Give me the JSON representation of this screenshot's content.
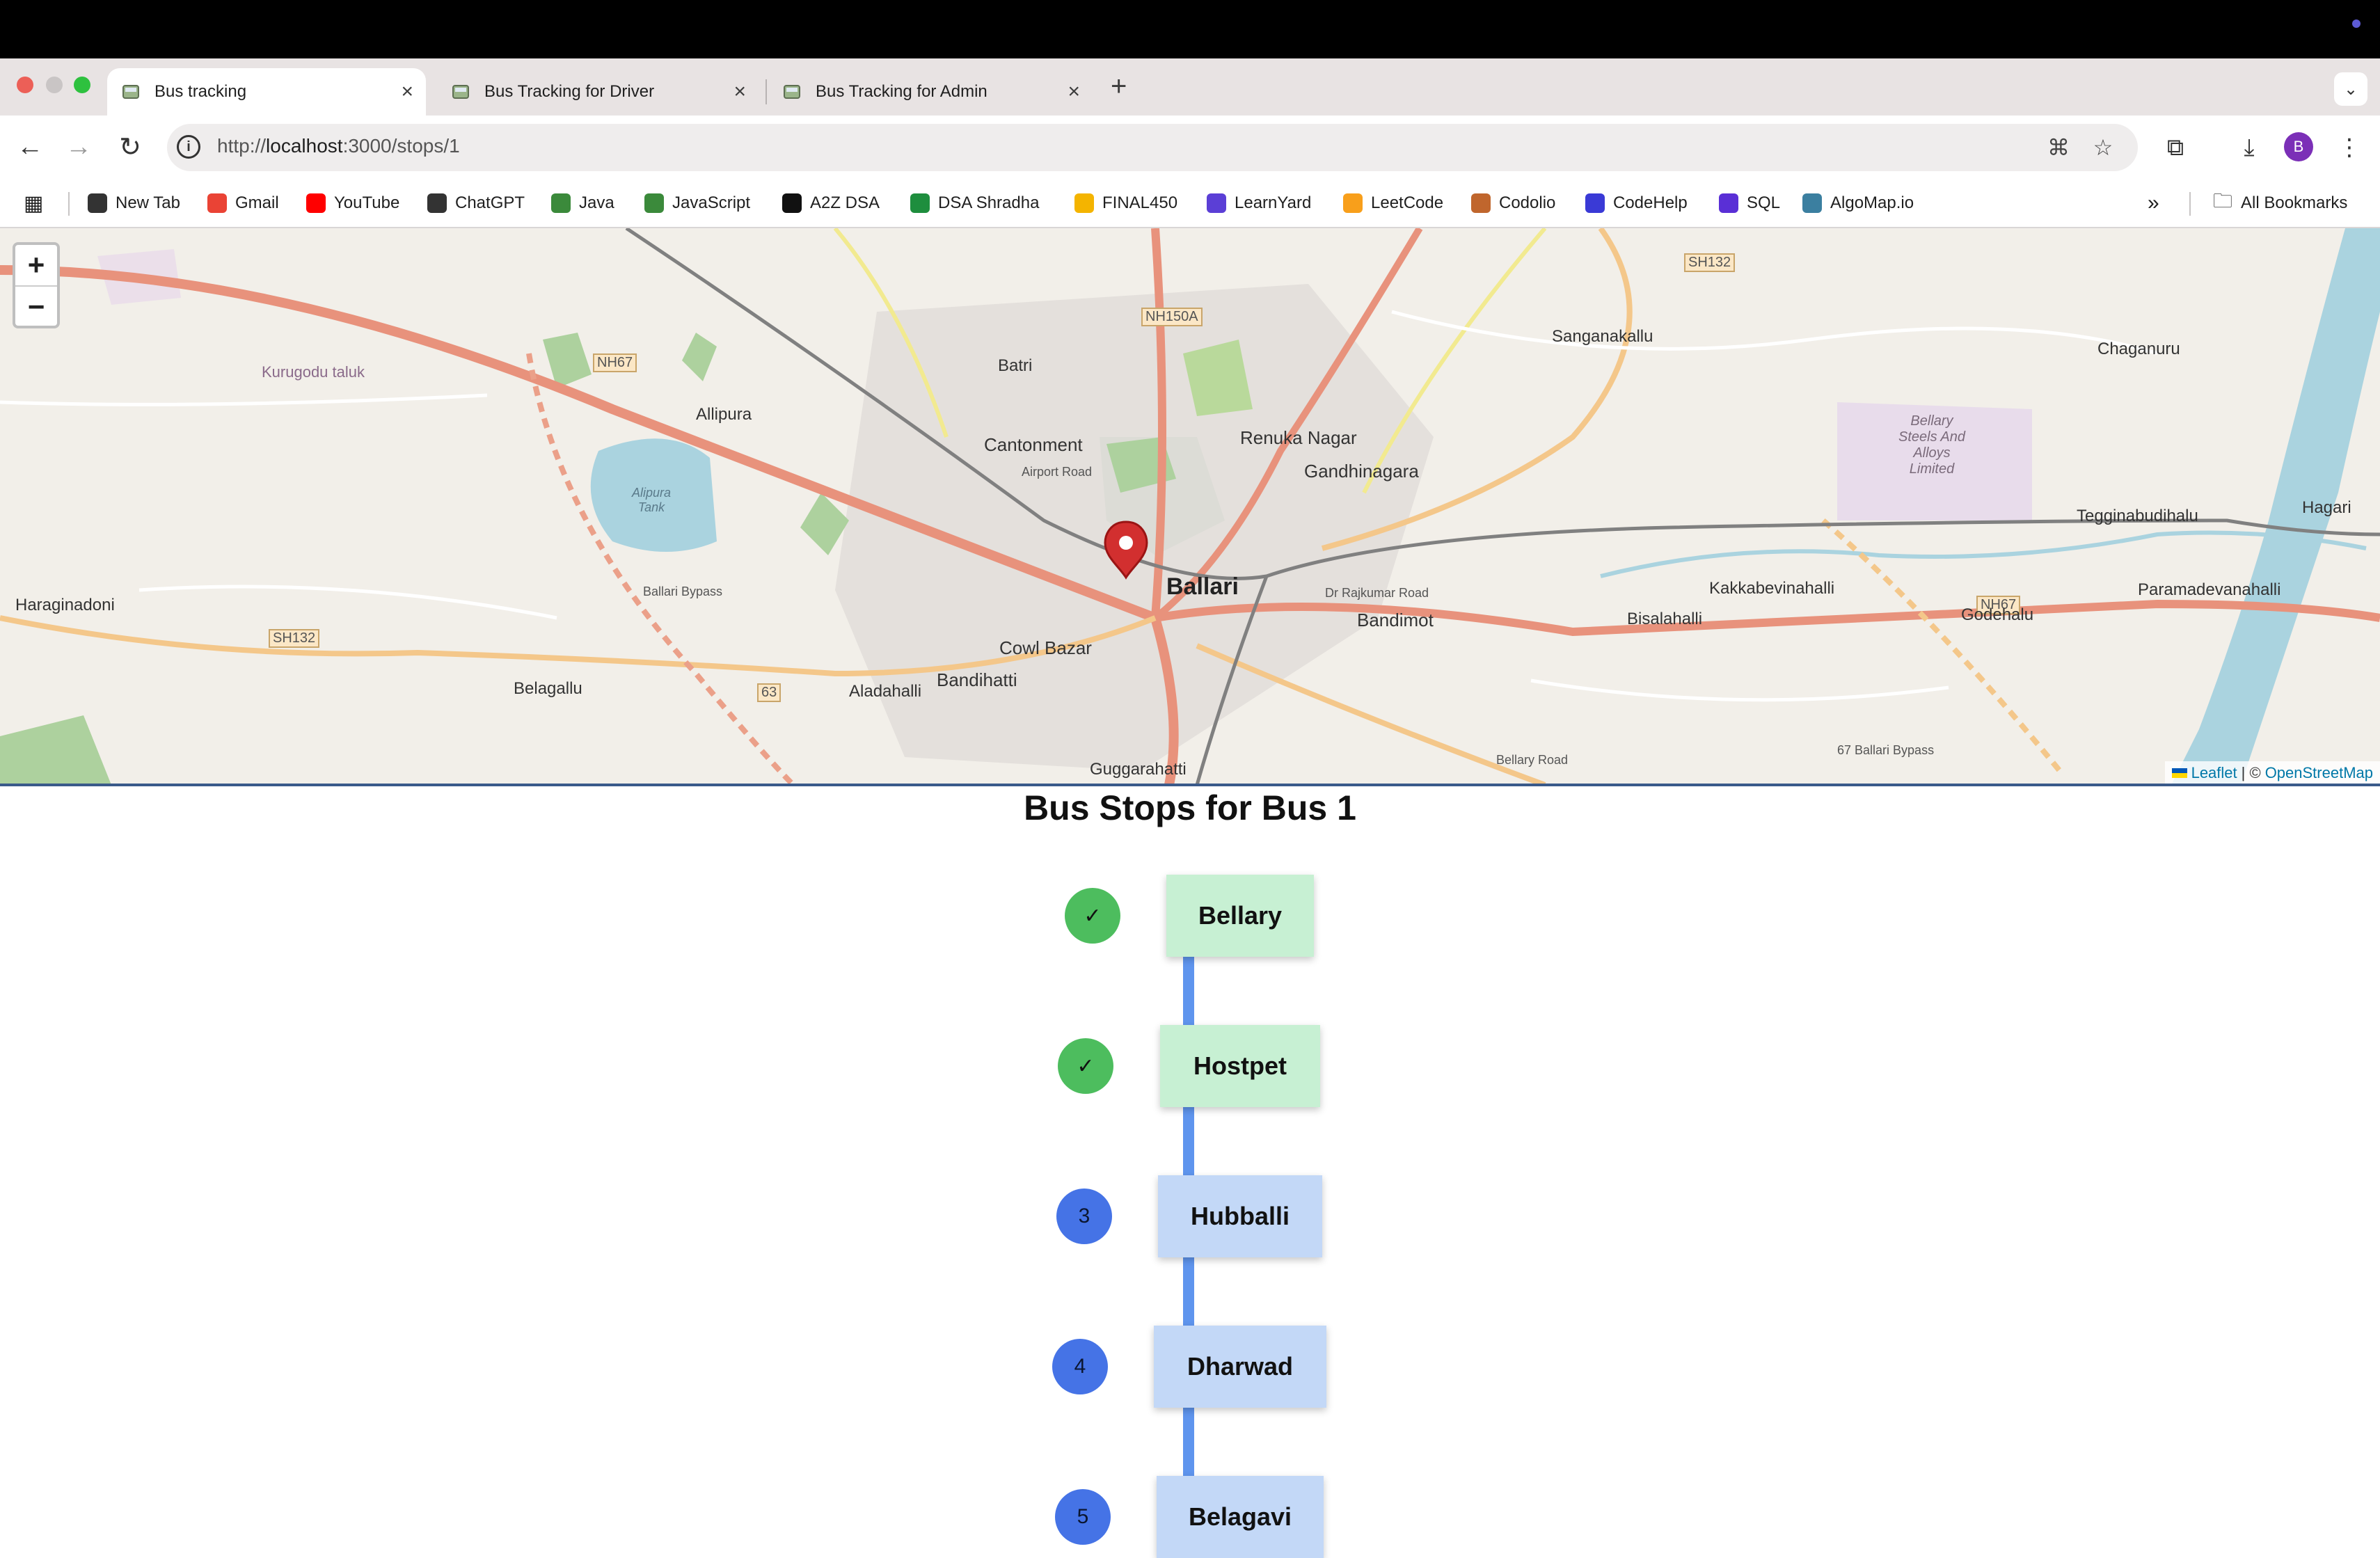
{
  "browser": {
    "tabs": [
      {
        "title": "Bus tracking",
        "active": true
      },
      {
        "title": "Bus Tracking for Driver",
        "active": false
      },
      {
        "title": "Bus Tracking for Admin",
        "active": false
      }
    ],
    "url_prefix": "http://",
    "url_host": "localhost",
    "url_path": ":3000/stops/1",
    "avatar_letter": "B",
    "bookmarks": [
      {
        "label": "New Tab",
        "icon": "globe-icon",
        "color": "#333333"
      },
      {
        "label": "Gmail",
        "icon": "gmail-icon",
        "color": "#ea4335"
      },
      {
        "label": "YouTube",
        "icon": "youtube-icon",
        "color": "#ff0000"
      },
      {
        "label": "ChatGPT",
        "icon": "chatgpt-icon",
        "color": "#333333"
      },
      {
        "label": "Java",
        "icon": "java-icon",
        "color": "#3b8a3b"
      },
      {
        "label": "JavaScript",
        "icon": "javascript-icon",
        "color": "#3b8a3b"
      },
      {
        "label": "A2Z DSA",
        "icon": "a2z-icon",
        "color": "#111111"
      },
      {
        "label": "DSA Shradha",
        "icon": "sheets-icon",
        "color": "#1e8e3e"
      },
      {
        "label": "FINAL450",
        "icon": "drive-icon",
        "color": "#f4b400"
      },
      {
        "label": "LearnYard",
        "icon": "learnyard-icon",
        "color": "#5b3fd6"
      },
      {
        "label": "LeetCode",
        "icon": "leetcode-icon",
        "color": "#f89f1b"
      },
      {
        "label": "Codolio",
        "icon": "codolio-icon",
        "color": "#c0662d"
      },
      {
        "label": "CodeHelp",
        "icon": "codehelp-icon",
        "color": "#3a3ad6"
      },
      {
        "label": "SQL",
        "icon": "sql-icon",
        "color": "#5a2fd6"
      },
      {
        "label": "AlgoMap.io",
        "icon": "algomap-icon",
        "color": "#3b7fa0"
      }
    ],
    "overflow_label": "»",
    "all_bookmarks": "All Bookmarks"
  },
  "map": {
    "zoom_in": "+",
    "zoom_out": "−",
    "labels": [
      "Kurugodu taluk",
      "NH67",
      "Allipura",
      "Alipura Tank",
      "Batri",
      "NH150A",
      "Cantonment",
      "Airport Road",
      "Renuka Nagar",
      "Gandhinagara",
      "Sanganakallu",
      "SH132",
      "Chaganuru",
      "Bellary Steels And Alloys Limited",
      "Tegginabudihalu",
      "Hagari",
      "Haraginadoni",
      "SH132",
      "Ballari Bypass",
      "Ballari",
      "Bandimot",
      "Cowl Bazar",
      "Bandihatti",
      "Aladahalli",
      "Belagallu",
      "63",
      "Bisalahalli",
      "Kakkabevinahalli",
      "NH67",
      "Godehalu",
      "Paramadevanahalli",
      "Dr Rajkumar Road",
      "Bellary Road",
      "67 Ballari Bypass",
      "Guggarahatti"
    ],
    "attribution": {
      "leaflet": "Leaflet",
      "sep": "| ©",
      "osm": "OpenStreetMap"
    }
  },
  "page": {
    "heading": "Bus Stops for Bus 1",
    "stops": [
      {
        "name": "Bellary",
        "badge": "✓",
        "status": "done"
      },
      {
        "name": "Hostpet",
        "badge": "✓",
        "status": "done"
      },
      {
        "name": "Hubballi",
        "badge": "3",
        "status": "pending"
      },
      {
        "name": "Dharwad",
        "badge": "4",
        "status": "pending"
      },
      {
        "name": "Belagavi",
        "badge": "5",
        "status": "pending"
      }
    ]
  },
  "colors": {
    "done": "#4dbd5e",
    "pending": "#4573e6",
    "rail": "#5f95ee"
  }
}
